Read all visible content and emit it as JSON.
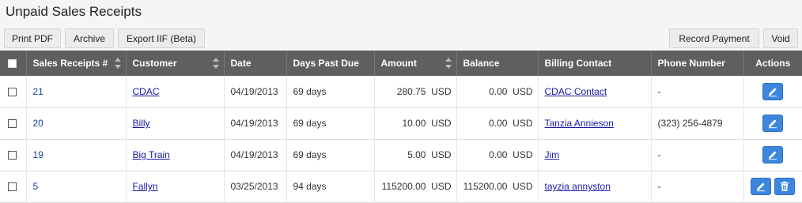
{
  "page": {
    "title": "Unpaid Sales Receipts"
  },
  "toolbar": {
    "print_pdf": "Print PDF",
    "archive": "Archive",
    "export_iif": "Export IIF (Beta)",
    "record_payment": "Record Payment",
    "void": "Void"
  },
  "table": {
    "headers": {
      "receipt": "Sales Receipts #",
      "customer": "Customer",
      "date": "Date",
      "days": "Days Past Due",
      "amount": "Amount",
      "balance": "Balance",
      "contact": "Billing Contact",
      "phone": "Phone Number",
      "actions": "Actions"
    },
    "rows": [
      {
        "id": "21",
        "customer": "CDAC",
        "date": "04/19/2013",
        "days": "69 days",
        "amount": "280.75",
        "amount_cur": "USD",
        "balance": "0.00",
        "balance_cur": "USD",
        "contact": "CDAC Contact",
        "phone": "-"
      },
      {
        "id": "20",
        "customer": "Billy",
        "date": "04/19/2013",
        "days": "69 days",
        "amount": "10.00",
        "amount_cur": "USD",
        "balance": "0.00",
        "balance_cur": "USD",
        "contact": "Tanzia Annieson",
        "phone": "(323) 256-4879"
      },
      {
        "id": "19",
        "customer": "Big Train",
        "date": "04/19/2013",
        "days": "69 days",
        "amount": "5.00",
        "amount_cur": "USD",
        "balance": "0.00",
        "balance_cur": "USD",
        "contact": "Jim",
        "phone": "-"
      },
      {
        "id": "5",
        "customer": "Fallyn",
        "date": "03/25/2013",
        "days": "94 days",
        "amount": "115200.00",
        "amount_cur": "USD",
        "balance": "115200.00",
        "balance_cur": "USD",
        "contact": "tayzia annyston",
        "phone": "-"
      }
    ]
  },
  "icons": {
    "edit": "pencil-icon",
    "delete": "trash-icon",
    "sort": "sort-arrows-icon"
  },
  "colors": {
    "header_bg": "#5f5f5f",
    "action_button": "#3c86e0",
    "link": "#1a1aa8"
  }
}
